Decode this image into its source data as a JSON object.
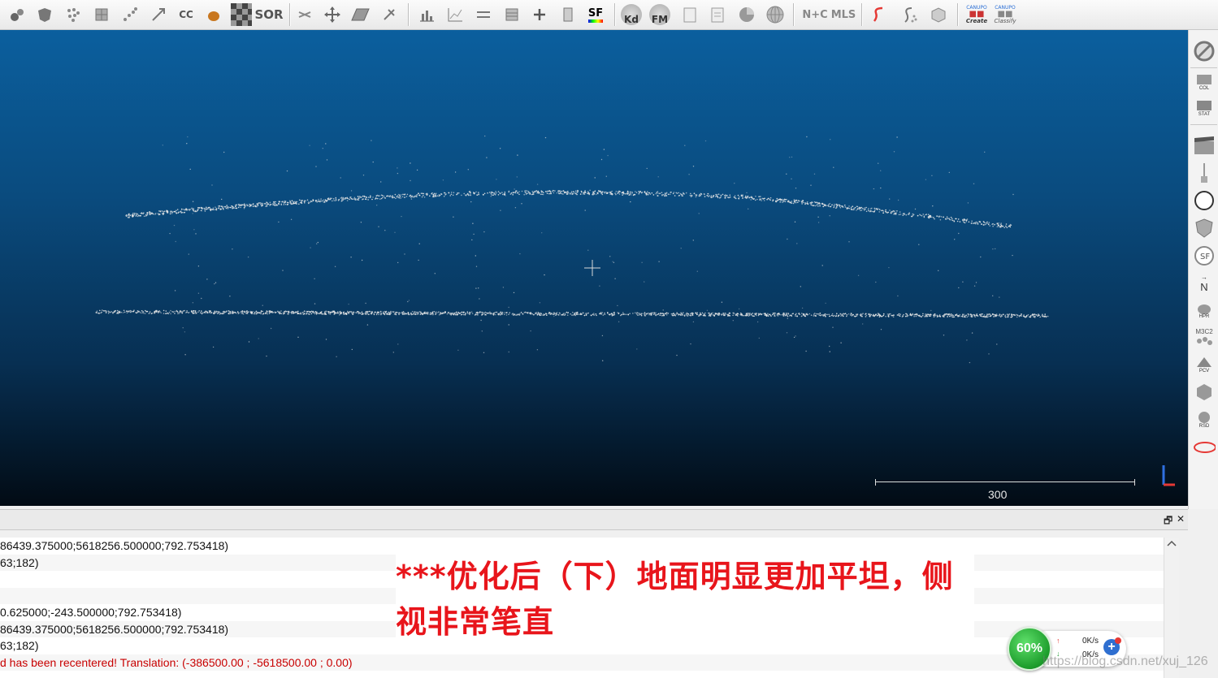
{
  "toolbar": {
    "text_icons": {
      "cc": "CC",
      "sor": "SOR",
      "sf": "SF",
      "kd": "Kd",
      "fm": "FM",
      "n_c": "N+C",
      "mls": "MLS",
      "canupo_create": "Create",
      "canupo_classify": "Classify",
      "canupo": "CANUPO"
    },
    "icons": [
      "tool-a-icon",
      "mesh-icon",
      "dots-icon",
      "grid-icon",
      "scatter-icon",
      "expand-icon",
      "cc-icon",
      "blob-icon",
      "checker-icon",
      "sor-icon",
      "cut-icon",
      "move-icon",
      "plane-icon",
      "tool-icon",
      "histogram-icon",
      "chart-icon",
      "minmax-icon",
      "stack-icon",
      "plus-icon",
      "calculator-icon",
      "sf-icon",
      "kd-icon",
      "fm-icon",
      "doc-icon",
      "csv-icon",
      "pie-icon",
      "sphere-icon",
      "nc-icon",
      "mls-icon",
      "s-icon",
      "scatter-s-icon",
      "cube-icon",
      "canupo-create-icon",
      "canupo-classify-icon"
    ]
  },
  "viewport": {
    "scale_label": "300",
    "background_top": "#0b5f9e",
    "background_bottom": "#020b14"
  },
  "sidebar": {
    "icons": [
      "no-entry-icon",
      "col-icon",
      "stats-icon",
      "clapper-icon",
      "probe-icon",
      "compass-icon",
      "shield-icon",
      "sf-badge-icon",
      "north-icon",
      "hpr-icon",
      "m3c2-icon",
      "pcv-icon",
      "hexagon-icon",
      "rsd-icon",
      "ellipse-icon"
    ],
    "labels": {
      "col": "COL",
      "stats": "STAT",
      "north": "N",
      "hpr": "HPR",
      "m3c2": "M3C2",
      "pcv": "PCV",
      "rsd": "RSD",
      "sf": "SF"
    }
  },
  "console": {
    "controls": {
      "float": "🗗",
      "close": "✕"
    },
    "lines": [
      {
        "text": "86439.375000;5618256.500000;792.753418)",
        "error": false
      },
      {
        "text": "63;182)",
        "error": false
      },
      {
        "text": "",
        "error": false
      },
      {
        "text": "",
        "error": false
      },
      {
        "text": "0.625000;-243.500000;792.753418)",
        "error": false
      },
      {
        "text": "86439.375000;5618256.500000;792.753418)",
        "error": false
      },
      {
        "text": "63;182)",
        "error": false
      },
      {
        "text": "d has been recentered! Translation: (-386500.00 ; -5618500.00 ; 0.00)",
        "error": true
      }
    ]
  },
  "annotation": {
    "text": "***优化后（下）地面明显更加平坦，侧视非常笔直",
    "color": "#e8151b"
  },
  "network_widget": {
    "percent": "60%",
    "upload": "0K/s",
    "download": "0K/s",
    "plus": "+"
  },
  "watermark": "https://blog.csdn.net/xuj_126"
}
